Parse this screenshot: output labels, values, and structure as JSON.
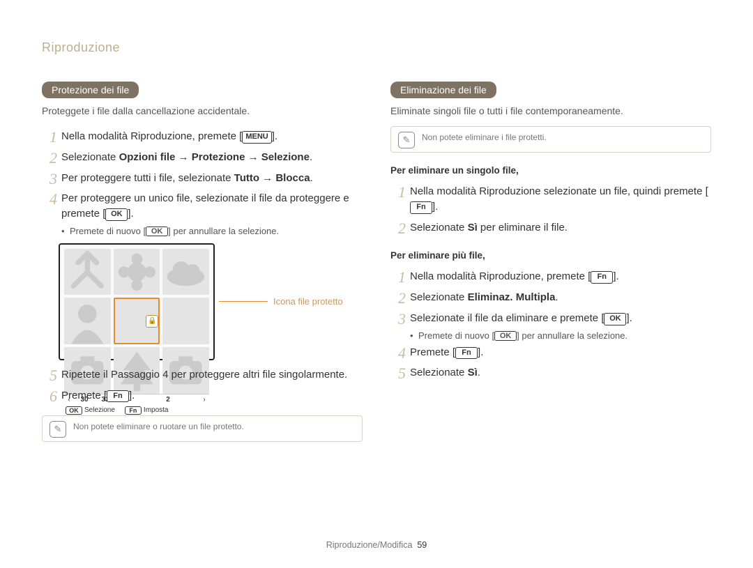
{
  "header": "Riproduzione",
  "left": {
    "pill": "Protezione dei file",
    "intro": "Proteggete i file dalla cancellazione accidentale.",
    "steps": [
      {
        "num": "1",
        "pre": "Nella modalità Riproduzione, premete [",
        "btn": "MENU",
        "post": "]."
      },
      {
        "num": "2",
        "pre": "Selezionate ",
        "bold": "Opzioni file → Protezione → Selezione",
        "post": "."
      },
      {
        "num": "3",
        "pre": "Per proteggere tutti i file, selezionate ",
        "bold": "Tutto → Blocca",
        "post": "."
      },
      {
        "num": "4",
        "pre": "Per proteggere un unico file, selezionate il file da proteggere e premete [",
        "btn": "OK",
        "post": "]."
      }
    ],
    "bullet4": {
      "pre": "Premete di nuovo [",
      "btn": "OK",
      "post": "] per annullare la selezione."
    },
    "figure": {
      "callout": "Icona file protetto",
      "dates": [
        "30",
        "31",
        "1",
        "",
        "2",
        ""
      ],
      "bottom": [
        {
          "btn": "OK",
          "label": "Selezione"
        },
        {
          "btn": "Fn",
          "label": "Imposta"
        }
      ]
    },
    "steps2": [
      {
        "num": "5",
        "text": "Ripetete il Passaggio 4 per proteggere altri file singolarmente."
      },
      {
        "num": "6",
        "pre": "Premete [",
        "btn": "Fn",
        "post": "]."
      }
    ],
    "note": "Non potete eliminare o ruotare un file protetto."
  },
  "right": {
    "pill": "Eliminazione dei file",
    "intro": "Eliminate singoli file o tutti i file contemporaneamente.",
    "note": "Non potete eliminare i file protetti.",
    "sub1": "Per eliminare un singolo file,",
    "steps1": [
      {
        "num": "1",
        "pre": "Nella modalità Riproduzione selezionate un file, quindi premete [",
        "btn": "Fn",
        "post": "]."
      },
      {
        "num": "2",
        "pre": "Selezionate ",
        "bold": "Sì",
        "post": " per eliminare il file."
      }
    ],
    "sub2": "Per eliminare più file,",
    "steps2": [
      {
        "num": "1",
        "pre": "Nella modalità Riproduzione, premete [",
        "btn": "Fn",
        "post": "]."
      },
      {
        "num": "2",
        "pre": "Selezionate ",
        "bold": "Eliminaz. Multipla",
        "post": "."
      },
      {
        "num": "3",
        "pre": "Selezionate il file da eliminare e premete [",
        "btn": "OK",
        "post": "]."
      }
    ],
    "bullet3": {
      "pre": "Premete di nuovo [",
      "btn": "OK",
      "post": "] per annullare la selezione."
    },
    "steps3": [
      {
        "num": "4",
        "pre": "Premete [",
        "btn": "Fn",
        "post": "]."
      },
      {
        "num": "5",
        "pre": "Selezionate ",
        "bold": "Sì",
        "post": "."
      }
    ]
  },
  "footer": {
    "text": "Riproduzione/Modifica",
    "page": "59"
  }
}
